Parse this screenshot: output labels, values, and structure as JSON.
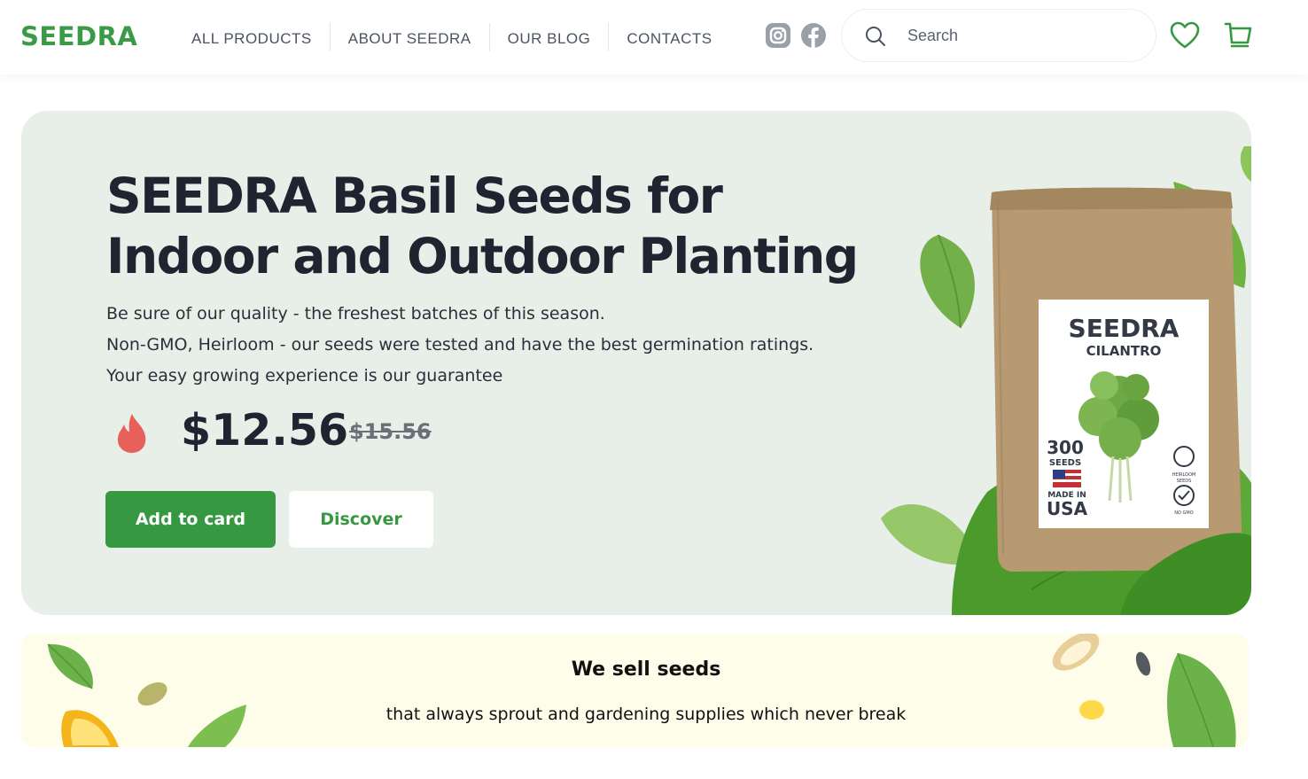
{
  "brand": {
    "logo": "SEEDRA",
    "accent_color": "#369840"
  },
  "nav": {
    "items": [
      {
        "label": "ALL PRODUCTS"
      },
      {
        "label": "ABOUT SEEDRA"
      },
      {
        "label": "OUR BLOG"
      },
      {
        "label": "CONTACTS"
      }
    ]
  },
  "header": {
    "social_icons": [
      "instagram-icon",
      "facebook-icon"
    ],
    "search": {
      "placeholder": "Search",
      "value": ""
    },
    "icons": [
      "heart-icon",
      "cart-icon"
    ]
  },
  "hero": {
    "title": "SEEDRA Basil Seeds for Indoor and Outdoor Planting",
    "description": [
      "Be sure of our quality - the freshest batches of this season.",
      "Non-GMO, Heirloom - our seeds were tested and have the best germination ratings.",
      "Your easy growing experience is our guarantee"
    ],
    "price": "$12.56",
    "old_price": "$15.56",
    "primary_button": "Add to card",
    "secondary_button": "Discover",
    "product_image": {
      "brand": "SEEDRA",
      "variety": "CILANTRO",
      "seeds_count": "300",
      "seeds_label": "SEEDS",
      "made_in_line1": "MADE IN",
      "made_in_line2": "USA",
      "badge1_line1": "HEIRLOOM",
      "badge1_line2": "SEEDS",
      "badge2": "NO GMO"
    }
  },
  "banner": {
    "title": "We sell seeds",
    "subtitle": "that always sprout and gardening supplies which never break"
  }
}
